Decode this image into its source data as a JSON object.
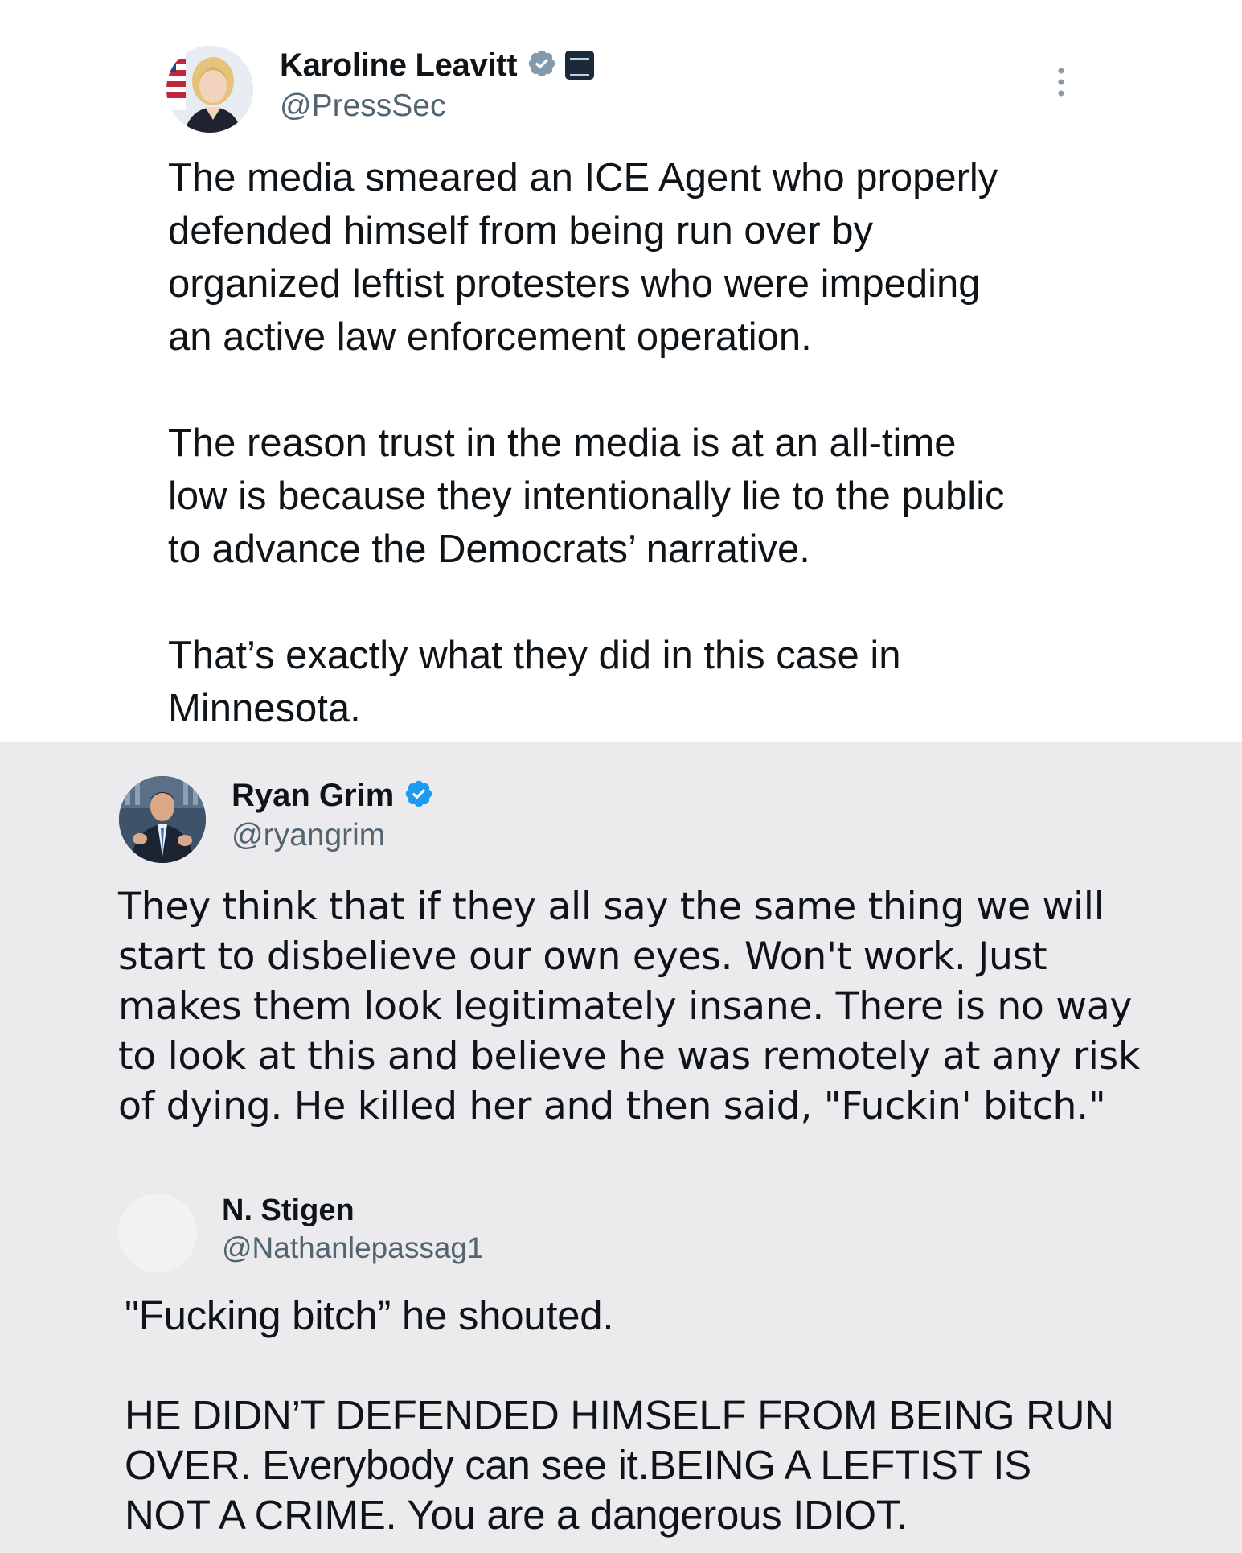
{
  "tweets": [
    {
      "author_name": "Karoline Leavitt",
      "handle": "@PressSec",
      "verified": true,
      "verified_badge_color": "#829aab",
      "affiliation_badge": "white-house-seal",
      "text": "The media smeared an ICE Agent who properly\ndefended himself from being run over by\norganized leftist protesters who were impeding\nan active law enforcement operation.\n\nThe reason trust in the media is at an all-time\nlow is because they intentionally lie to the public\nto advance the Democrats’ narrative.\n\nThat’s exactly what they did in this case in\nMinnesota.",
      "background": "#ffffff"
    },
    {
      "author_name": "Ryan Grim",
      "handle": "@ryangrim",
      "verified": true,
      "verified_badge_color": "#1d9bf0",
      "text": "They think that if they all say the same thing we will\nstart to disbelieve our own eyes. Won't work. Just\nmakes them look legitimately insane. There is no way\nto look at this and believe he was remotely at any risk\nof dying. He killed her and then said, \"Fuckin' bitch.\"",
      "background": "#ebebed"
    },
    {
      "author_name": "N. Stigen",
      "handle": "@Nathanlepassag1",
      "verified": false,
      "text": "\"Fucking bitch” he shouted.\n\nHE DIDN’T DEFENDED HIMSELF FROM BEING RUN\nOVER. Everybody can see it.BEING A LEFTIST IS\nNOT A CRIME. You are a dangerous IDIOT.",
      "background": "#ebebed"
    }
  ],
  "icons": {
    "verified": "verified-badge-icon",
    "affiliation": "white-house-badge-icon",
    "more": "more-options-icon"
  },
  "colors": {
    "text": "#0f1419",
    "handle": "#536471",
    "separator_panel": "#ebebed"
  }
}
